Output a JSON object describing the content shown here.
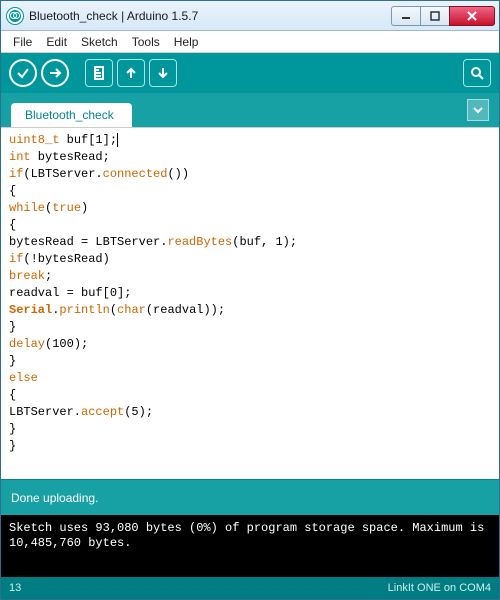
{
  "window": {
    "title": "Bluetooth_check | Arduino 1.5.7"
  },
  "menu": {
    "file": "File",
    "edit": "Edit",
    "sketch": "Sketch",
    "tools": "Tools",
    "help": "Help"
  },
  "tabs": {
    "active": "Bluetooth_check"
  },
  "code": {
    "l1a": "uint8_t",
    "l1b": " buf[1];",
    "l2a": "int",
    "l2b": " bytesRead;",
    "l3a": "if",
    "l3b": "(LBTServer.",
    "l3c": "connected",
    "l3d": "())",
    "l4": "{",
    "l5a": "while",
    "l5b": "(",
    "l5c": "true",
    "l5d": ")",
    "l6": "{",
    "l7a": "bytesRead = LBTServer.",
    "l7b": "readBytes",
    "l7c": "(buf, 1);",
    "l8a": "if",
    "l8b": "(!bytesRead)",
    "l9a": "break",
    "l9b": ";",
    "l10": "readval = buf[0];",
    "l11a": "Serial",
    "l11b": ".",
    "l11c": "println",
    "l11d": "(",
    "l11e": "char",
    "l11f": "(readval));",
    "l12": "}",
    "l13a": "delay",
    "l13b": "(100);",
    "l14": "}",
    "l15": "else",
    "l16": "{",
    "l17a": "LBTServer.",
    "l17b": "accept",
    "l17c": "(5);",
    "l18": "}",
    "l19": "}"
  },
  "status": {
    "upload_msg": "Done uploading."
  },
  "console": {
    "line1": "Sketch uses 93,080 bytes (0%) of program storage space. Maximum is",
    "line2": "10,485,760 bytes."
  },
  "footer": {
    "line_no": "13",
    "board": "LinkIt ONE on COM4"
  }
}
